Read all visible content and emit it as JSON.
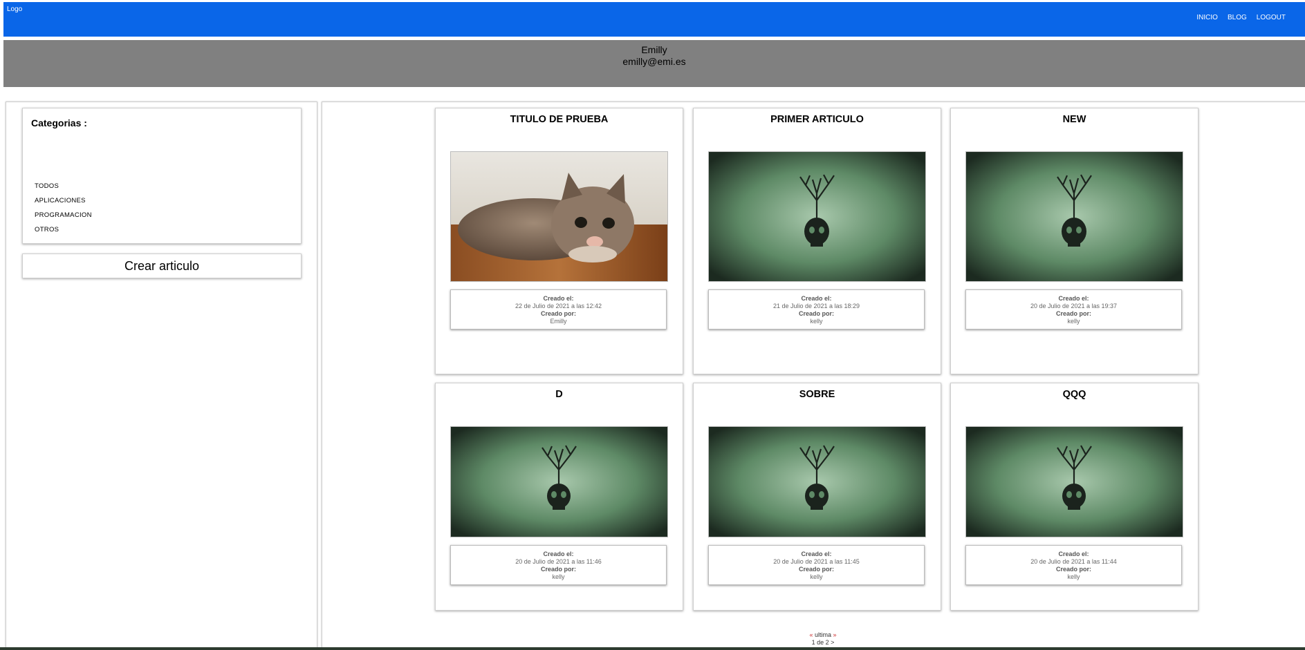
{
  "header": {
    "logo": "Logo",
    "nav": [
      "INICIO",
      "BLOG",
      "LOGOUT"
    ]
  },
  "profile": {
    "name": "Emilly",
    "email": "emilly@emi.es"
  },
  "sidebar": {
    "categories_title": "Categorias :",
    "categories": [
      "TODOS",
      "APLICACIONES",
      "PROGRAMACION",
      "OTROS"
    ],
    "create_button": "Crear articulo"
  },
  "articles": [
    {
      "title": "TITULO DE PRUEBA",
      "image": "cat-photo",
      "created_label": "Creado el:",
      "date": "22 de Julio de 2021 a las 12:42",
      "author_label": "Creado por:",
      "author": "Emilly"
    },
    {
      "title": "PRIMER ARTICULO",
      "image": "skull-tree-art",
      "created_label": "Creado el:",
      "date": "21 de Julio de 2021 a las 18:29",
      "author_label": "Creado por:",
      "author": "kelly"
    },
    {
      "title": "NEW",
      "image": "skull-tree-art",
      "created_label": "Creado el:",
      "date": "20 de Julio de 2021 a las 19:37",
      "author_label": "Creado por:",
      "author": "kelly"
    },
    {
      "title": "D",
      "image": "skull-tree-art",
      "created_label": "Creado el:",
      "date": "20 de Julio de 2021 a las 11:46",
      "author_label": "Creado por:",
      "author": "kelly"
    },
    {
      "title": "SOBRE",
      "image": "skull-tree-art",
      "created_label": "Creado el:",
      "date": "20 de Julio de 2021 a las 11:45",
      "author_label": "Creado por:",
      "author": "kelly"
    },
    {
      "title": "QQQ",
      "image": "skull-tree-art",
      "created_label": "Creado el:",
      "date": "20 de Julio de 2021 a las 11:44",
      "author_label": "Creado por:",
      "author": "kelly"
    }
  ],
  "pagination": {
    "prev": "«",
    "last": "ultima",
    "next": "»",
    "page_info": "1 de 2",
    "next_arrow": ">"
  },
  "colors": {
    "topbar": "#0a66e8",
    "profile_band": "#808080",
    "art_bg": "#5f8a68"
  }
}
